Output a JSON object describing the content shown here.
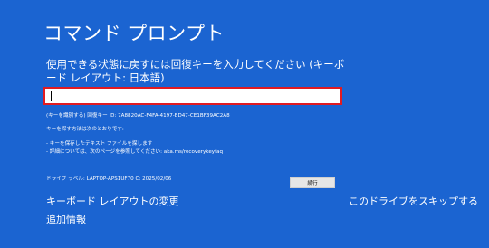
{
  "header": {
    "title": "コマンド プロンプト"
  },
  "prompt": {
    "text": "使用できる状態に戻すには回復キーを入力してください (キーボード レイアウト: 日本語)"
  },
  "recovery_key_input": {
    "value": ""
  },
  "key_id": {
    "text": "(キーを識別する) 回復キー ID: 7A8820AC-F4FA-4197-BD47-CE1BF39AC2A8"
  },
  "help": {
    "heading": "キーを探す方法は次のとおりです:",
    "bullets": [
      "- キーを保存したテキスト ファイルを探します",
      "- 詳細については、次のページを参照してください: aka.ms/recoverykeyfaq"
    ]
  },
  "drive_label": {
    "text": "ドライブ ラベル: LAPTOP-APS1UF70 C: 2025/02/06"
  },
  "buttons": {
    "run": "続行"
  },
  "links": {
    "change_layout": "キーボード レイアウトの変更",
    "skip_drive": "このドライブをスキップする",
    "more_info": "追加情報"
  },
  "colors": {
    "background": "#1b64d1",
    "input_border": "#e11b22"
  }
}
